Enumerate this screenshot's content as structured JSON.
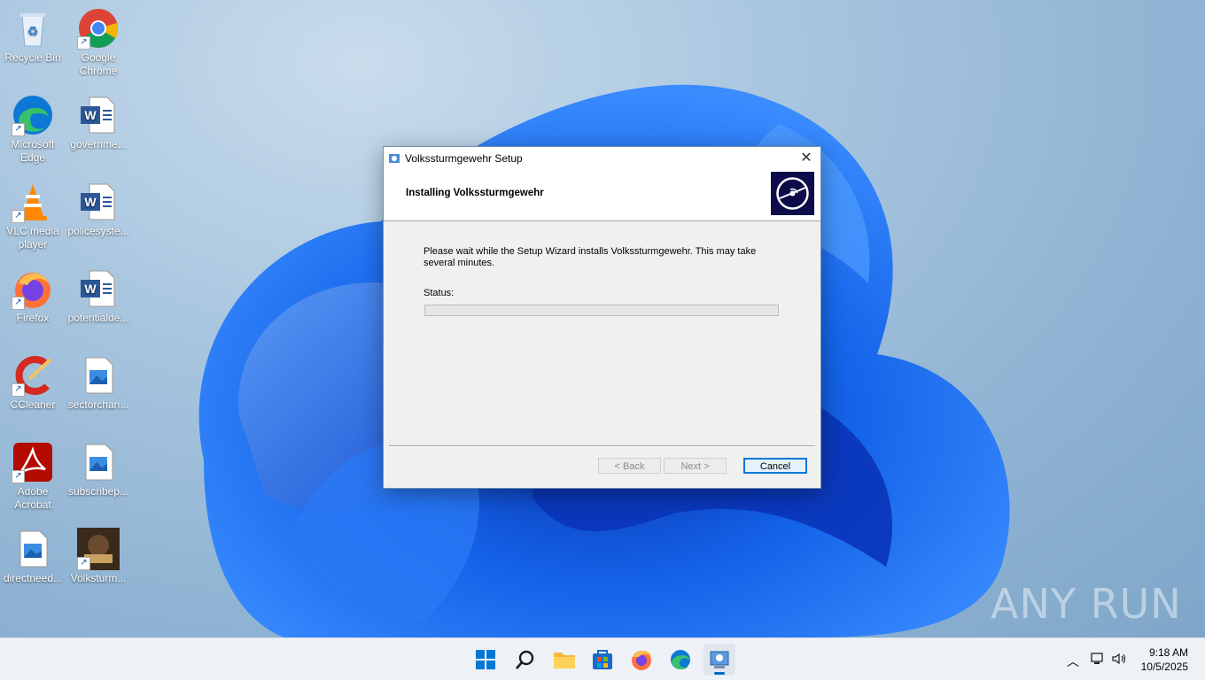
{
  "desktop": {
    "icons": [
      {
        "label": "Recycle Bin",
        "name": "recycle-bin"
      },
      {
        "label": "Google Chrome",
        "name": "google-chrome"
      },
      {
        "label": "Microsoft Edge",
        "name": "microsoft-edge"
      },
      {
        "label": "governme...",
        "name": "word-doc-governme"
      },
      {
        "label": "VLC media player",
        "name": "vlc-media-player"
      },
      {
        "label": "policesyste...",
        "name": "word-doc-policesyste"
      },
      {
        "label": "Firefox",
        "name": "firefox"
      },
      {
        "label": "potentialde...",
        "name": "word-doc-potentialde"
      },
      {
        "label": "CCleaner",
        "name": "ccleaner"
      },
      {
        "label": "sectorchan...",
        "name": "image-sectorchan"
      },
      {
        "label": "Adobe Acrobat",
        "name": "adobe-acrobat"
      },
      {
        "label": "subscribep...",
        "name": "image-subscribep"
      },
      {
        "label": "directneed...",
        "name": "image-directneed"
      },
      {
        "label": "Volksturm...",
        "name": "volksturm-shortcut"
      }
    ],
    "watermark": "ANY RUN"
  },
  "dialog": {
    "title": "Volkssturmgewehr Setup",
    "heading": "Installing Volkssturmgewehr",
    "message": "Please wait while the Setup Wizard installs Volkssturmgewehr.  This may take several minutes.",
    "status_label": "Status:",
    "progress": 0,
    "buttons": {
      "back": "< Back",
      "next": "Next >",
      "cancel": "Cancel"
    }
  },
  "taskbar": {
    "apps": [
      "start-icon",
      "search-icon",
      "file-explorer-icon",
      "store-icon",
      "firefox-icon",
      "edge-icon",
      "installer-icon"
    ],
    "clock": {
      "time": "9:18 AM",
      "date": "10/5/2025"
    }
  }
}
